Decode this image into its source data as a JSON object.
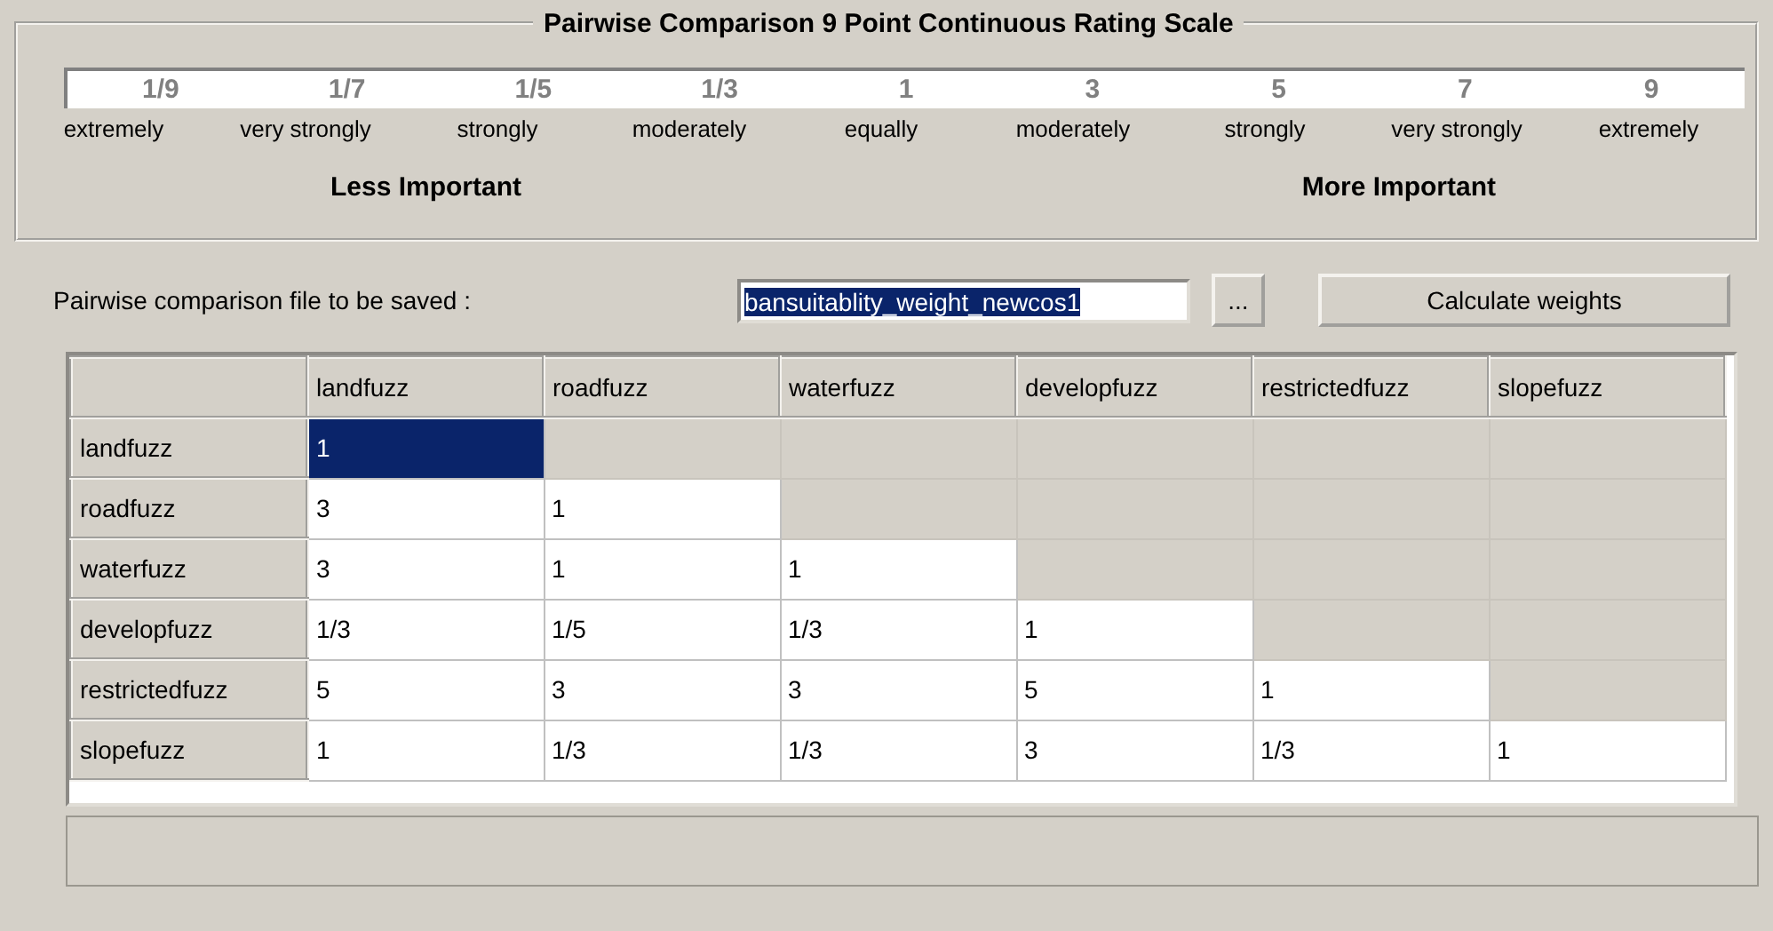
{
  "scale_group": {
    "title": "Pairwise Comparison 9 Point Continuous Rating Scale",
    "ticks": [
      {
        "value": "1/9",
        "label": "extremely"
      },
      {
        "value": "1/7",
        "label": "very strongly"
      },
      {
        "value": "1/5",
        "label": "strongly"
      },
      {
        "value": "1/3",
        "label": "moderately"
      },
      {
        "value": "1",
        "label": "equally"
      },
      {
        "value": "3",
        "label": "moderately"
      },
      {
        "value": "5",
        "label": "strongly"
      },
      {
        "value": "7",
        "label": "very strongly"
      },
      {
        "value": "9",
        "label": "extremely"
      }
    ],
    "left_caption": "Less Important",
    "right_caption": "More Important"
  },
  "file_row": {
    "label": "Pairwise comparison file to be saved :",
    "value": "bansuitablity_weight_newcos1",
    "value_selected": true,
    "browse_button": "...",
    "calculate_button": "Calculate weights"
  },
  "table": {
    "columns": [
      "landfuzz",
      "roadfuzz",
      "waterfuzz",
      "developfuzz",
      "restrictedfuzz",
      "slopefuzz"
    ],
    "rows": [
      {
        "header": "landfuzz",
        "cells": [
          {
            "value": "1",
            "selected": true,
            "disabled": false
          },
          {
            "selected": false,
            "disabled": true
          },
          {
            "selected": false,
            "disabled": true
          },
          {
            "selected": false,
            "disabled": true
          },
          {
            "selected": false,
            "disabled": true
          },
          {
            "selected": false,
            "disabled": true
          }
        ]
      },
      {
        "header": "roadfuzz",
        "cells": [
          {
            "value": "3",
            "selected": false,
            "disabled": false
          },
          {
            "value": "1",
            "selected": false,
            "disabled": false
          },
          {
            "selected": false,
            "disabled": true
          },
          {
            "selected": false,
            "disabled": true
          },
          {
            "selected": false,
            "disabled": true
          },
          {
            "selected": false,
            "disabled": true
          }
        ]
      },
      {
        "header": "waterfuzz",
        "cells": [
          {
            "value": "3",
            "selected": false,
            "disabled": false
          },
          {
            "value": "1",
            "selected": false,
            "disabled": false
          },
          {
            "value": "1",
            "selected": false,
            "disabled": false
          },
          {
            "selected": false,
            "disabled": true
          },
          {
            "selected": false,
            "disabled": true
          },
          {
            "selected": false,
            "disabled": true
          }
        ]
      },
      {
        "header": "developfuzz",
        "cells": [
          {
            "value": "1/3",
            "selected": false,
            "disabled": false
          },
          {
            "value": "1/5",
            "selected": false,
            "disabled": false
          },
          {
            "value": "1/3",
            "selected": false,
            "disabled": false
          },
          {
            "value": "1",
            "selected": false,
            "disabled": false
          },
          {
            "selected": false,
            "disabled": true
          },
          {
            "selected": false,
            "disabled": true
          }
        ]
      },
      {
        "header": "restrictedfuzz",
        "cells": [
          {
            "value": "5",
            "selected": false,
            "disabled": false
          },
          {
            "value": "3",
            "selected": false,
            "disabled": false
          },
          {
            "value": "3",
            "selected": false,
            "disabled": false
          },
          {
            "value": "5",
            "selected": false,
            "disabled": false
          },
          {
            "value": "1",
            "selected": false,
            "disabled": false
          },
          {
            "selected": false,
            "disabled": true
          }
        ]
      },
      {
        "header": "slopefuzz",
        "cells": [
          {
            "value": "1",
            "selected": false,
            "disabled": false
          },
          {
            "value": "1/3",
            "selected": false,
            "disabled": false
          },
          {
            "value": "1/3",
            "selected": false,
            "disabled": false
          },
          {
            "value": "3",
            "selected": false,
            "disabled": false
          },
          {
            "value": "1/3",
            "selected": false,
            "disabled": false
          },
          {
            "value": "1",
            "selected": false,
            "disabled": false
          }
        ]
      }
    ]
  }
}
